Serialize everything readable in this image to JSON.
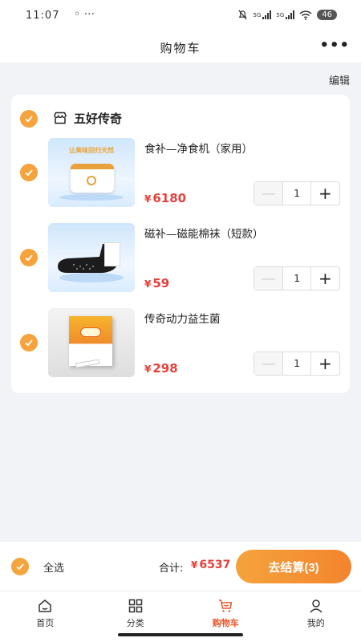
{
  "status_bar": {
    "time": "11:07",
    "dots": "◦ ···",
    "network1": "5G",
    "network2": "5G",
    "battery": "46"
  },
  "header": {
    "title": "购物车",
    "more": "•••"
  },
  "edit_label": "编辑",
  "shop": {
    "name": "五好传奇",
    "items": [
      {
        "name": "食补—净食机（家用）",
        "currency": "¥",
        "price": "6180",
        "quantity": "1",
        "banner_text": "让美味回归天然"
      },
      {
        "name": "磁补—磁能棉袜（短款）",
        "currency": "¥",
        "price": "59",
        "quantity": "1"
      },
      {
        "name": "传奇动力益生菌",
        "currency": "¥",
        "price": "298",
        "quantity": "1"
      }
    ]
  },
  "checkout": {
    "select_all": "全选",
    "total_label": "合计:",
    "currency": "¥",
    "total": "6537",
    "pay_label": "去结算(3)"
  },
  "tabs": [
    {
      "label": "首页",
      "icon": "home-icon"
    },
    {
      "label": "分类",
      "icon": "grid-icon"
    },
    {
      "label": "购物车",
      "icon": "cart-icon",
      "active": true
    },
    {
      "label": "我的",
      "icon": "user-icon"
    }
  ],
  "colors": {
    "accent": "#f5a33c",
    "price": "#e5403a",
    "active_tab": "#e8552b"
  }
}
